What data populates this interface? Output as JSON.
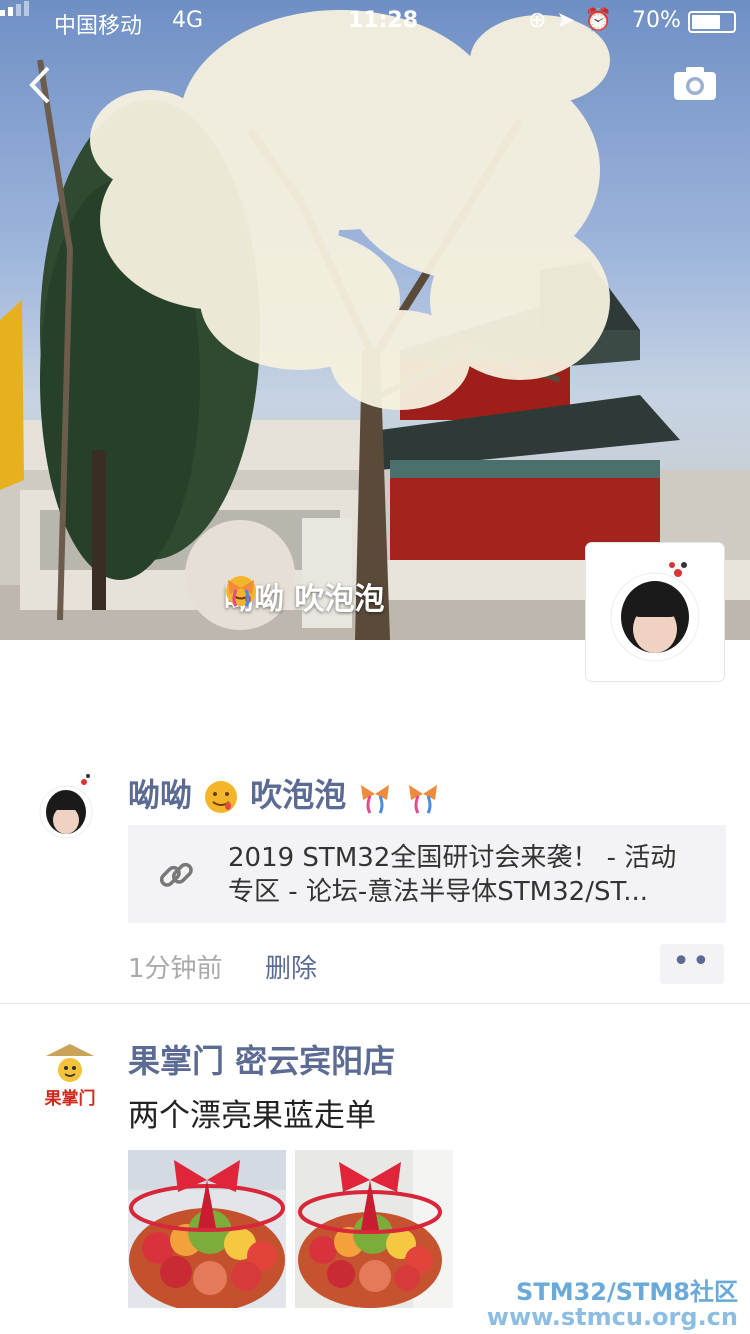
{
  "status_bar": {
    "carrier": "中国移动",
    "network": "4G",
    "time": "11:28",
    "battery": "70%",
    "battery_level": 0.7
  },
  "profile": {
    "name": "呦呦",
    "name_suffix": "吹泡泡"
  },
  "posts": [
    {
      "author": "呦呦",
      "author_suffix": "吹泡泡",
      "link_title": "2019 STM32全国研讨会来袭！ - 活动\n专区 - 论坛-意法半导体STM32/ST...",
      "time": "1分钟前",
      "delete_label": "删除",
      "more_label": "••"
    },
    {
      "author": "果掌门  密云宾阳店",
      "text": "两个漂亮果蓝走单",
      "logo_text": "果掌门"
    }
  ],
  "watermark": {
    "line1": "STM32/STM8社区",
    "line2": "www.stmcu.org.cn"
  },
  "icons": {
    "back": "chevron-left-icon",
    "camera": "camera-icon",
    "link": "link-icon"
  }
}
